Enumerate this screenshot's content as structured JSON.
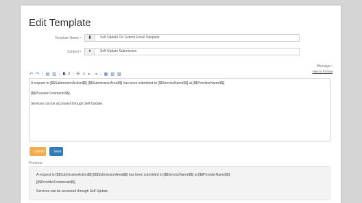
{
  "form": {
    "title": "Edit Template",
    "template_name_label": "Template Name •",
    "template_name_value": "Self Update On Submit Email Template",
    "subject_label": "Subject •",
    "subject_value": "Self Update Submission",
    "message_label": "Message •",
    "how_to_link": "How to Format"
  },
  "toolbar": {
    "buttons": [
      "↶",
      "↷",
      "▤",
      "▥",
      "B",
      "I",
      "☰",
      "≡",
      "⇤",
      "⇥",
      "▦",
      "▧",
      "▨"
    ]
  },
  "editor": {
    "lines": [
      "A request to [$$SubmissionAction$$] [$$SubmissionArea$$] has been submitted to [$$ServiceName$$] at [$$ProviderName$$].",
      "[$$ProviderComments$$]",
      "Services can be accessed through Self Update."
    ]
  },
  "actions": {
    "cancel": "Cancel",
    "save": "Save"
  },
  "preview": {
    "label": "Preview",
    "lines": [
      "A request to [$$SubmissionAction$$] [$$SubmissionArea$$] has been submitted to [$$ServiceName$$] at [$$ProviderName$$].",
      "[$$ProviderComments$$]",
      "Services can be accessed through Self Update."
    ]
  },
  "colors": {
    "cancel": "#f0ad4e",
    "save": "#337ab7",
    "page_bg": "#d5d5d5"
  },
  "icons": {
    "template_name": "file-icon",
    "subject": "tag-icon"
  }
}
